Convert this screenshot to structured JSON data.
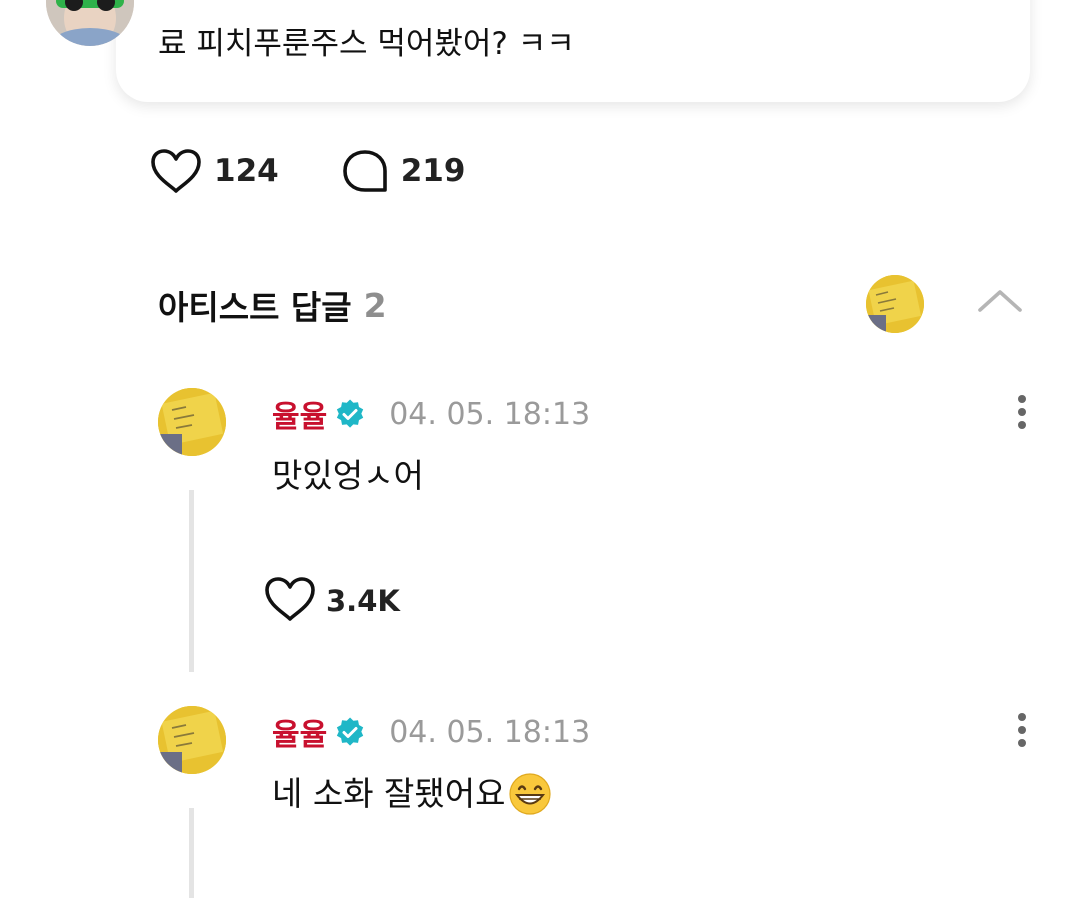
{
  "post": {
    "text": "료 피치푸룬주스 먹어봤어? ㅋㅋ",
    "avatar_icon": "user-avatar-photo",
    "likes": "124",
    "comments": "219"
  },
  "replies_section": {
    "title": "아티스트 답글",
    "count": "2",
    "collapse_icon": "chevron-up-icon"
  },
  "replies": [
    {
      "author": "율율",
      "badge_icon": "verified-badge-icon",
      "timestamp": "04. 05. 18:13",
      "text": "맛있엉ㅅ어",
      "likes": "3.4K"
    },
    {
      "author": "율율",
      "badge_icon": "verified-badge-icon",
      "timestamp": "04. 05. 18:13",
      "text": "네 소화 잘됐어요",
      "emoji": "grinning-face-emoji"
    }
  ],
  "colors": {
    "author": "#c8102e",
    "verified": "#1fb7c7",
    "muted": "#9a9a9a",
    "count_gray": "#8e8e8e",
    "thread_line": "#e4e4e4"
  }
}
